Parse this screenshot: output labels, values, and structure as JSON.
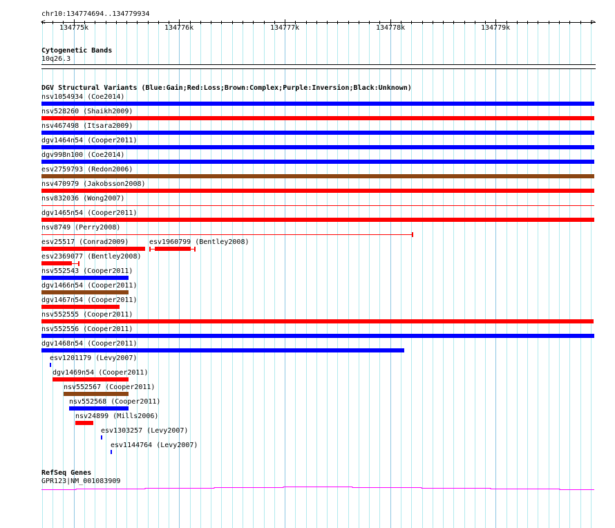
{
  "ruler": {
    "region_label": "chr10:134774694..134779934",
    "start": 134774694,
    "end": 134779934,
    "major_ticks": [
      {
        "pos": 134775000,
        "label": "134775k"
      },
      {
        "pos": 134776000,
        "label": "134776k"
      },
      {
        "pos": 134777000,
        "label": "134777k"
      },
      {
        "pos": 134778000,
        "label": "134778k"
      },
      {
        "pos": 134779000,
        "label": "134779k"
      }
    ]
  },
  "cytoband": {
    "title": "Cytogenetic Bands",
    "band_label": "10q26.3"
  },
  "dgv": {
    "title": "DGV Structural Variants (Blue:Gain;Red:Loss;Brown:Complex;Purple:Inversion;Black:Unknown)",
    "colors": {
      "gain": "#0000ff",
      "loss": "#ff0000",
      "complex": "#8b4513"
    },
    "rows": [
      [
        {
          "label": "nsv1054934 (Coe2014)",
          "type": "gain",
          "start": 134774694,
          "end": 134779934,
          "style": "thick"
        }
      ],
      [
        {
          "label": "nsv528260 (Shaikh2009)",
          "type": "loss",
          "start": 134774694,
          "end": 134779934,
          "style": "thick"
        }
      ],
      [
        {
          "label": "nsv467498 (Itsara2009)",
          "type": "gain",
          "start": 134774694,
          "end": 134779934,
          "style": "thick"
        }
      ],
      [
        {
          "label": "dgv1464n54 (Cooper2011)",
          "type": "gain",
          "start": 134774694,
          "end": 134779934,
          "style": "thick"
        }
      ],
      [
        {
          "label": "dgv998n100 (Coe2014)",
          "type": "gain",
          "start": 134774694,
          "end": 134779934,
          "style": "thick"
        }
      ],
      [
        {
          "label": "esv2759793 (Redon2006)",
          "type": "complex",
          "start": 134774694,
          "end": 134779934,
          "style": "thick"
        }
      ],
      [
        {
          "label": "nsv470979 (Jakobsson2008)",
          "type": "loss",
          "start": 134774694,
          "end": 134779934,
          "style": "thick"
        }
      ],
      [
        {
          "label": "nsv832036 (Wong2007)",
          "type": "loss",
          "start": 134774694,
          "end": 134779934,
          "style": "line"
        }
      ],
      [
        {
          "label": "dgv1465n54 (Cooper2011)",
          "type": "loss",
          "start": 134774694,
          "end": 134779934,
          "style": "thick"
        }
      ],
      [
        {
          "label": "nsv8749 (Perry2008)",
          "type": "loss",
          "start": 134774694,
          "end": 134778211,
          "style": "line",
          "end_tick": true
        }
      ],
      [
        {
          "label": "esv25517 (Conrad2009)",
          "type": "loss",
          "start": 134774694,
          "end": 134775677,
          "style": "thick"
        },
        {
          "label": "esv1960799 (Bentley2008)",
          "type": "loss",
          "start": 134775716,
          "end": 134776148,
          "style": "line",
          "thick_start": 134775768,
          "thick_end": 134776109,
          "start_tick": true,
          "end_tick": true
        }
      ],
      [
        {
          "label": "esv2369077 (Bentley2008)",
          "type": "loss",
          "start": 134774694,
          "end": 134775048,
          "style": "line",
          "thick_start": 134774694,
          "thick_end": 134774982,
          "end_tick": true
        }
      ],
      [
        {
          "label": "nsv552543 (Cooper2011)",
          "type": "gain",
          "start": 134774694,
          "end": 134775519,
          "style": "thick"
        }
      ],
      [
        {
          "label": "dgv1466n54 (Cooper2011)",
          "type": "complex",
          "start": 134774694,
          "end": 134775519,
          "style": "thick"
        }
      ],
      [
        {
          "label": "dgv1467n54 (Cooper2011)",
          "type": "loss",
          "start": 134774694,
          "end": 134775434,
          "style": "thick"
        }
      ],
      [
        {
          "label": "nsv552555 (Cooper2011)",
          "type": "loss",
          "start": 134774694,
          "end": 134779927,
          "style": "thick"
        }
      ],
      [
        {
          "label": "nsv552556 (Cooper2011)",
          "type": "gain",
          "start": 134774694,
          "end": 134779934,
          "style": "thick"
        }
      ],
      [
        {
          "label": "dgv1468n54 (Cooper2011)",
          "type": "gain",
          "start": 134774694,
          "end": 134778133,
          "style": "thick"
        }
      ],
      [
        {
          "label": "esv1201179 (Levy2007)",
          "type": "gain",
          "start": 134774773,
          "end": 134774786,
          "style": "thick"
        }
      ],
      [
        {
          "label": "dgv1469n54 (Cooper2011)",
          "type": "loss",
          "start": 134774799,
          "end": 134775519,
          "style": "thick"
        }
      ],
      [
        {
          "label": "nsv552567 (Cooper2011)",
          "type": "complex",
          "start": 134774904,
          "end": 134775519,
          "style": "thick"
        }
      ],
      [
        {
          "label": "nsv552568 (Cooper2011)",
          "type": "gain",
          "start": 134774956,
          "end": 134775519,
          "style": "thick"
        }
      ],
      [
        {
          "label": "nsv24899 (Mills2006)",
          "type": "loss",
          "start": 134775015,
          "end": 134775185,
          "style": "thick"
        }
      ],
      [
        {
          "label": "esv1303257 (Levy2007)",
          "type": "gain",
          "start": 134775257,
          "end": 134775270,
          "style": "thick"
        }
      ],
      [
        {
          "label": "esv1144764 (Levy2007)",
          "type": "gain",
          "start": 134775349,
          "end": 134775362,
          "style": "thick"
        }
      ]
    ]
  },
  "refseq": {
    "title": "RefSeq Genes",
    "gene_label": "GPR123|NM_001083909",
    "color": "#ff00ff"
  }
}
